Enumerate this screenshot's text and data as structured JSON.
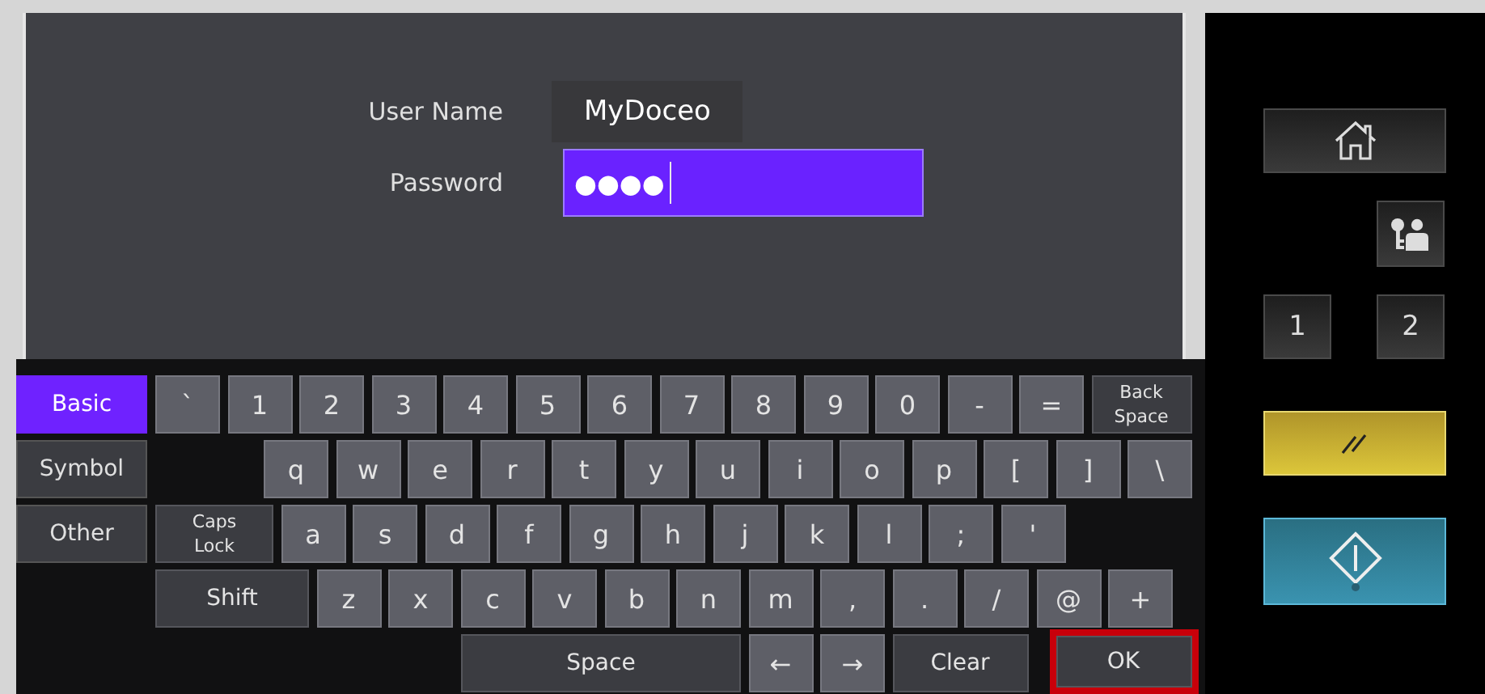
{
  "form": {
    "fields": [
      {
        "label": "User Name",
        "value": "MyDoceo",
        "focused": false
      },
      {
        "label": "Password",
        "value": "●●●●",
        "focused": true
      }
    ]
  },
  "keyboard": {
    "modes": [
      {
        "label": "Basic",
        "selected": true
      },
      {
        "label": "Symbol",
        "selected": false
      },
      {
        "label": "Other",
        "selected": false
      }
    ],
    "rows": [
      {
        "keys": [
          {
            "kind": "char",
            "label": "`",
            "highlighted": false
          },
          {
            "kind": "char",
            "label": "1",
            "highlighted": false
          },
          {
            "kind": "char",
            "label": "2",
            "highlighted": false
          },
          {
            "kind": "char",
            "label": "3",
            "highlighted": false
          },
          {
            "kind": "char",
            "label": "4",
            "highlighted": false
          },
          {
            "kind": "char",
            "label": "5",
            "highlighted": false
          },
          {
            "kind": "char",
            "label": "6",
            "highlighted": false
          },
          {
            "kind": "char",
            "label": "7",
            "highlighted": false
          },
          {
            "kind": "char",
            "label": "8",
            "highlighted": false
          },
          {
            "kind": "char",
            "label": "9",
            "highlighted": false
          },
          {
            "kind": "char",
            "label": "0",
            "highlighted": false
          },
          {
            "kind": "char",
            "label": "-",
            "highlighted": false
          },
          {
            "kind": "char",
            "label": "=",
            "highlighted": false
          },
          {
            "kind": "backspace",
            "label": "Back Space",
            "highlighted": false
          }
        ]
      },
      {
        "keys": [
          {
            "kind": "char",
            "label": "q",
            "highlighted": false
          },
          {
            "kind": "char",
            "label": "w",
            "highlighted": false
          },
          {
            "kind": "char",
            "label": "e",
            "highlighted": false
          },
          {
            "kind": "char",
            "label": "r",
            "highlighted": false
          },
          {
            "kind": "char",
            "label": "t",
            "highlighted": false
          },
          {
            "kind": "char",
            "label": "y",
            "highlighted": false
          },
          {
            "kind": "char",
            "label": "u",
            "highlighted": false
          },
          {
            "kind": "char",
            "label": "i",
            "highlighted": false
          },
          {
            "kind": "char",
            "label": "o",
            "highlighted": false
          },
          {
            "kind": "char",
            "label": "p",
            "highlighted": false
          },
          {
            "kind": "char",
            "label": "[",
            "highlighted": false
          },
          {
            "kind": "char",
            "label": "]",
            "highlighted": false
          },
          {
            "kind": "char",
            "label": "\\",
            "highlighted": false
          }
        ]
      },
      {
        "keys": [
          {
            "kind": "capslock",
            "label": "Caps Lock",
            "highlighted": false
          },
          {
            "kind": "char",
            "label": "a",
            "highlighted": false
          },
          {
            "kind": "char",
            "label": "s",
            "highlighted": false
          },
          {
            "kind": "char",
            "label": "d",
            "highlighted": false
          },
          {
            "kind": "char",
            "label": "f",
            "highlighted": false
          },
          {
            "kind": "char",
            "label": "g",
            "highlighted": false
          },
          {
            "kind": "char",
            "label": "h",
            "highlighted": false
          },
          {
            "kind": "char",
            "label": "j",
            "highlighted": false
          },
          {
            "kind": "char",
            "label": "k",
            "highlighted": false
          },
          {
            "kind": "char",
            "label": "l",
            "highlighted": false
          },
          {
            "kind": "char",
            "label": ";",
            "highlighted": false
          },
          {
            "kind": "char",
            "label": "'",
            "highlighted": false
          }
        ]
      },
      {
        "keys": [
          {
            "kind": "shift",
            "label": "Shift",
            "highlighted": false
          },
          {
            "kind": "char",
            "label": "z",
            "highlighted": false
          },
          {
            "kind": "char",
            "label": "x",
            "highlighted": false
          },
          {
            "kind": "char",
            "label": "c",
            "highlighted": false
          },
          {
            "kind": "char",
            "label": "v",
            "highlighted": false
          },
          {
            "kind": "char",
            "label": "b",
            "highlighted": false
          },
          {
            "kind": "char",
            "label": "n",
            "highlighted": false
          },
          {
            "kind": "char",
            "label": "m",
            "highlighted": false
          },
          {
            "kind": "char",
            "label": ",",
            "highlighted": false
          },
          {
            "kind": "char",
            "label": ".",
            "highlighted": false
          },
          {
            "kind": "char",
            "label": "/",
            "highlighted": false
          },
          {
            "kind": "char",
            "label": "@",
            "highlighted": false
          },
          {
            "kind": "char",
            "label": "+",
            "highlighted": false
          }
        ]
      },
      {
        "keys": [
          {
            "kind": "space",
            "label": "Space",
            "highlighted": false
          },
          {
            "kind": "arrow",
            "label": "←",
            "highlighted": false
          },
          {
            "kind": "arrow",
            "label": "→",
            "highlighted": false
          },
          {
            "kind": "clear",
            "label": "Clear",
            "highlighted": false
          },
          {
            "kind": "ok",
            "label": "OK",
            "highlighted": true
          }
        ]
      }
    ]
  },
  "side_buttons": [
    {
      "kind": "home"
    },
    {
      "kind": "account"
    },
    {
      "kind": "number",
      "label": "1"
    },
    {
      "kind": "number",
      "label": "2"
    },
    {
      "kind": "reset"
    },
    {
      "kind": "start"
    }
  ]
}
